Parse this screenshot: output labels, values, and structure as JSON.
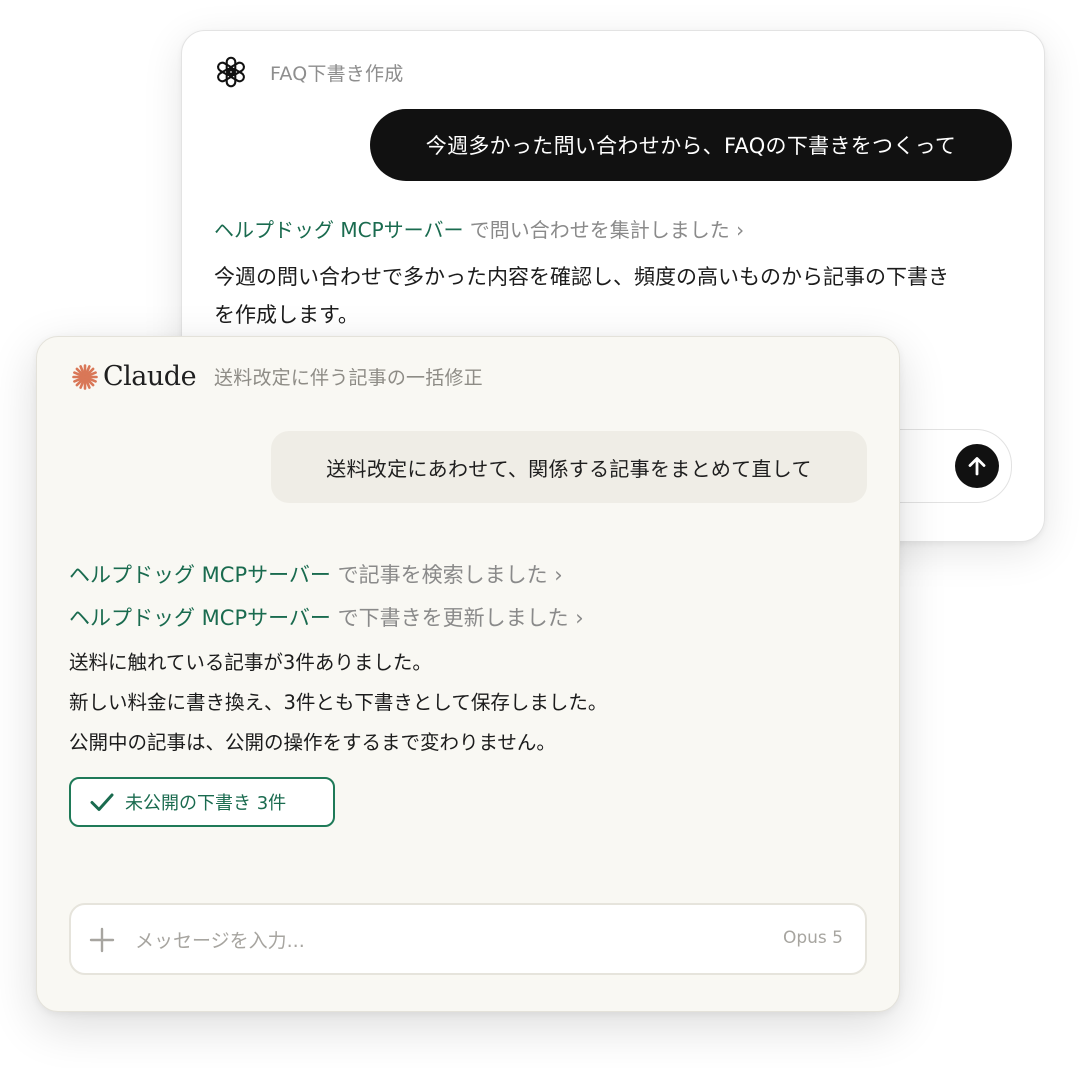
{
  "back_window": {
    "title": "FAQ下書き作成",
    "user_message": "今週多かった問い合わせから、FAQの下書きをつくって",
    "tool_call": {
      "source": "ヘルプドッグ MCPサーバー",
      "action": " で問い合わせを集計しました",
      "chevron": "›"
    },
    "response_lines": [
      "今週の問い合わせで多かった内容を確認し、頻度の高いものから記事の下書き",
      "を作成します。"
    ]
  },
  "front_window": {
    "brand": "Claude",
    "title": "送料改定に伴う記事の一括修正",
    "user_message": "送料改定にあわせて、関係する記事をまとめて直して",
    "tool_calls": [
      {
        "source": "ヘルプドッグ MCPサーバー",
        "action": " で記事を検索しました",
        "chevron": " ›"
      },
      {
        "source": "ヘルプドッグ MCPサーバー",
        "action": " で下書きを更新しました",
        "chevron": " ›"
      }
    ],
    "response_lines": [
      "送料に触れている記事が3件ありました。",
      "新しい料金に書き換え、3件とも下書きとして保存しました。",
      "公開中の記事は、公開の操作をするまで変わりません。"
    ],
    "badge": "未公開の下書き 3件",
    "input": {
      "placeholder": "メッセージを入力...",
      "value": ""
    },
    "model": "Opus 5"
  },
  "colors": {
    "accent_green": "#1a6b4f",
    "claude_orange": "#d97757",
    "front_bg": "#f9f8f3",
    "dark_bubble": "#111111"
  },
  "icons": [
    "openai-logo-icon",
    "claude-starburst-icon",
    "send-arrow-icon",
    "check-icon",
    "plus-icon"
  ]
}
